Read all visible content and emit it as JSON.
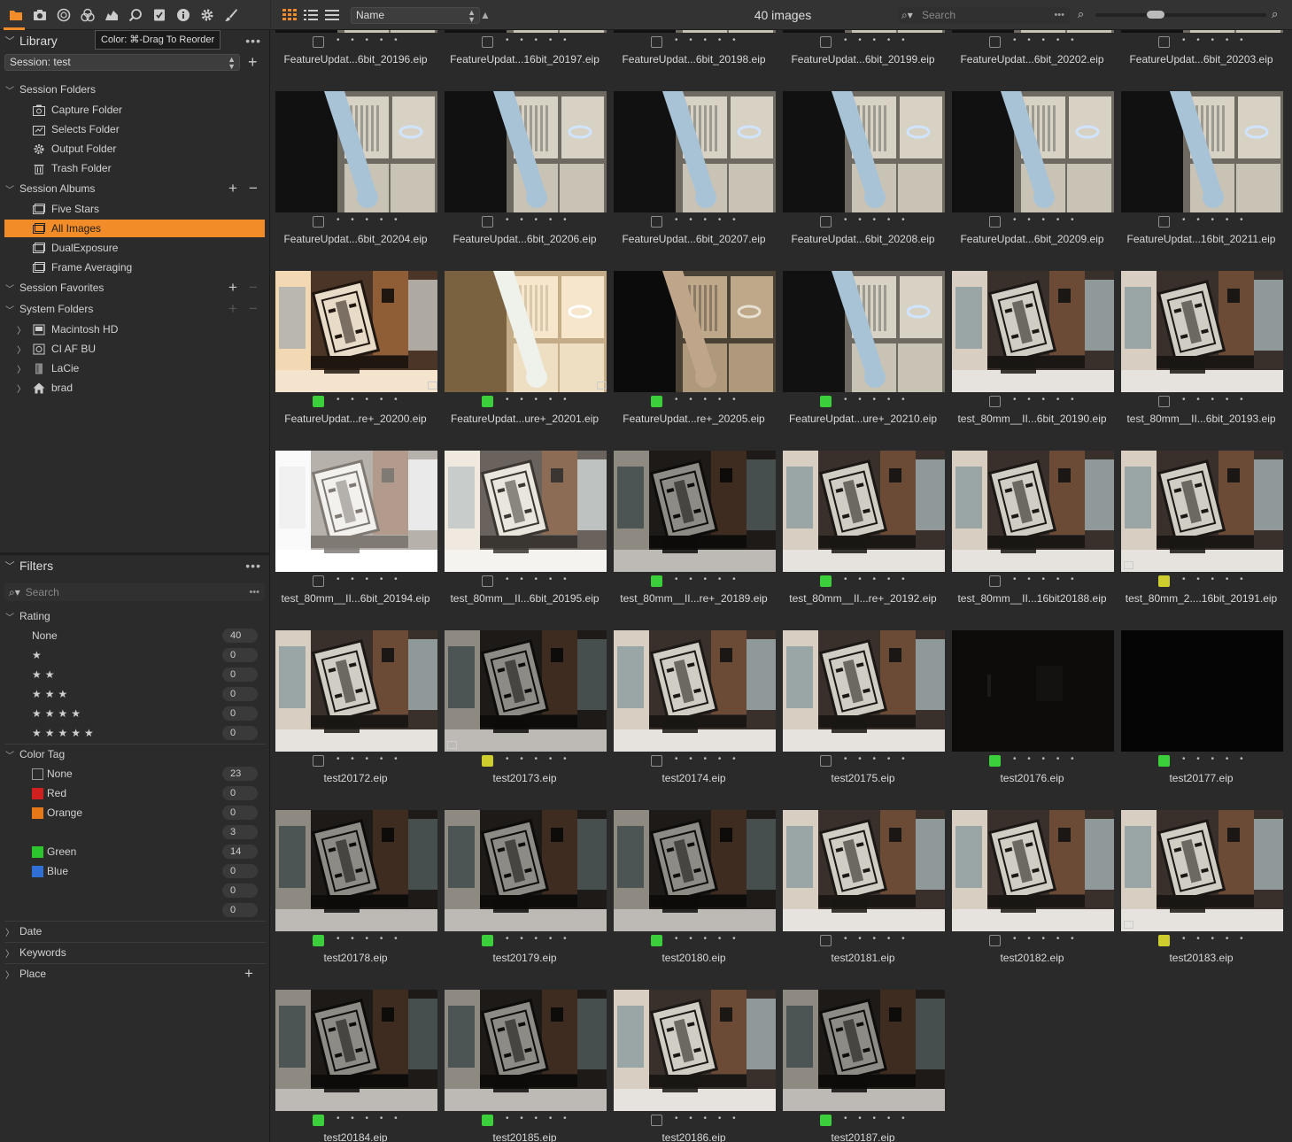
{
  "tool_tabs": [
    {
      "name": "library-tab-icon",
      "glyph": "folder",
      "active": true
    },
    {
      "name": "capture-tab-icon",
      "glyph": "camera"
    },
    {
      "name": "lens-tab-icon",
      "glyph": "circle"
    },
    {
      "name": "color-tab-icon",
      "glyph": "rgb"
    },
    {
      "name": "exposure-tab-icon",
      "glyph": "histogram"
    },
    {
      "name": "details-tab-icon",
      "glyph": "magnifier"
    },
    {
      "name": "adjustments-tab-icon",
      "glyph": "check"
    },
    {
      "name": "metadata-tab-icon",
      "glyph": "info"
    },
    {
      "name": "output-tab-icon",
      "glyph": "gear"
    },
    {
      "name": "brush-tab-icon",
      "glyph": "brush"
    }
  ],
  "library": {
    "title": "Library",
    "tooltip": "Color: ⌘-Drag To Reorder",
    "session": "Session: test",
    "sections": {
      "session_folders": "Session Folders",
      "session_albums": "Session Albums",
      "session_favorites": "Session Favorites",
      "system_folders": "System Folders"
    },
    "session_folders": [
      "Capture Folder",
      "Selects Folder",
      "Output Folder",
      "Trash Folder"
    ],
    "session_albums": [
      "Five Stars",
      "All Images",
      "DualExposure",
      "Frame Averaging"
    ],
    "system_folders": [
      "Macintosh HD",
      "CI AF BU",
      "LaCie",
      "brad"
    ],
    "selected_album": "All Images"
  },
  "filters": {
    "title": "Filters",
    "search_placeholder": "Search",
    "rating_title": "Rating",
    "rating": [
      {
        "label": "None",
        "count": "40"
      },
      {
        "stars": "★",
        "count": "0"
      },
      {
        "stars": "★★",
        "count": "0"
      },
      {
        "stars": "★★★",
        "count": "0"
      },
      {
        "stars": "★★★★",
        "count": "0"
      },
      {
        "stars": "★★★★★",
        "count": "0"
      }
    ],
    "color_tag_title": "Color Tag",
    "color_tags": [
      {
        "label": "None",
        "count": "23",
        "color": "none"
      },
      {
        "label": "Red",
        "count": "0",
        "color": "#d01f1f"
      },
      {
        "label": "Orange",
        "count": "0",
        "color": "#e77817"
      },
      {
        "label": "",
        "count": "3",
        "color": ""
      },
      {
        "label": "Green",
        "count": "14",
        "color": "#2dc52d"
      },
      {
        "label": "Blue",
        "count": "0",
        "color": "#2f6fd6"
      },
      {
        "label": "",
        "count": "0",
        "color": ""
      },
      {
        "label": "",
        "count": "0",
        "color": ""
      }
    ],
    "date": "Date",
    "keywords": "Keywords",
    "place": "Place"
  },
  "toolbar": {
    "sort_by": "Name",
    "image_count": "40 images",
    "search_placeholder": "Search",
    "zoom_level": 0.35
  },
  "browser": {
    "images": [
      {
        "name": "FeatureUpdat...6bit_20196.eip",
        "tag": "none",
        "scene": "top"
      },
      {
        "name": "FeatureUpdat...16bit_20197.eip",
        "tag": "none",
        "scene": "top"
      },
      {
        "name": "FeatureUpdat...6bit_20198.eip",
        "tag": "none",
        "scene": "top"
      },
      {
        "name": "FeatureUpdat...6bit_20199.eip",
        "tag": "none",
        "scene": "top"
      },
      {
        "name": "FeatureUpdat...6bit_20202.eip",
        "tag": "none",
        "scene": "top"
      },
      {
        "name": "FeatureUpdat...6bit_20203.eip",
        "tag": "none",
        "scene": "top"
      },
      {
        "name": "FeatureUpdat...6bit_20204.eip",
        "tag": "none",
        "scene": "lamp"
      },
      {
        "name": "FeatureUpdat...6bit_20206.eip",
        "tag": "none",
        "scene": "lamp"
      },
      {
        "name": "FeatureUpdat...6bit_20207.eip",
        "tag": "none",
        "scene": "lamp"
      },
      {
        "name": "FeatureUpdat...6bit_20208.eip",
        "tag": "none",
        "scene": "lamp"
      },
      {
        "name": "FeatureUpdat...6bit_20209.eip",
        "tag": "none",
        "scene": "lamp"
      },
      {
        "name": "FeatureUpdat...16bit_20211.eip",
        "tag": "none",
        "scene": "lamp"
      },
      {
        "name": "FeatureUpdat...re+_20200.eip",
        "tag": "green",
        "scene": "chart-warm",
        "badge": "right"
      },
      {
        "name": "FeatureUpdat...ure+_20201.eip",
        "tag": "green",
        "scene": "lamp-bright",
        "badge": "right"
      },
      {
        "name": "FeatureUpdat...re+_20205.eip",
        "tag": "green",
        "scene": "lamp-dark"
      },
      {
        "name": "FeatureUpdat...ure+_20210.eip",
        "tag": "green",
        "scene": "lamp"
      },
      {
        "name": "test_80mm__II...6bit_20190.eip",
        "tag": "none",
        "scene": "chart"
      },
      {
        "name": "test_80mm__II...6bit_20193.eip",
        "tag": "none",
        "scene": "chart"
      },
      {
        "name": "test_80mm__II...6bit_20194.eip",
        "tag": "none",
        "scene": "chart-white"
      },
      {
        "name": "test_80mm__II...6bit_20195.eip",
        "tag": "none",
        "scene": "chart-light"
      },
      {
        "name": "test_80mm__II...re+_20189.eip",
        "tag": "green",
        "scene": "chart-dark"
      },
      {
        "name": "test_80mm__II...re+_20192.eip",
        "tag": "green",
        "scene": "chart"
      },
      {
        "name": "test_80mm__II...16bit20188.eip",
        "tag": "none",
        "scene": "chart"
      },
      {
        "name": "test_80mm_2....16bit_20191.eip",
        "tag": "yellow",
        "scene": "chart",
        "badge": "left"
      },
      {
        "name": "test20172.eip",
        "tag": "none",
        "scene": "chart"
      },
      {
        "name": "test20173.eip",
        "tag": "yellow",
        "scene": "chart-dark",
        "badge": "left"
      },
      {
        "name": "test20174.eip",
        "tag": "none",
        "scene": "chart"
      },
      {
        "name": "test20175.eip",
        "tag": "none",
        "scene": "chart"
      },
      {
        "name": "test20176.eip",
        "tag": "green",
        "scene": "black-dim"
      },
      {
        "name": "test20177.eip",
        "tag": "green",
        "scene": "black"
      },
      {
        "name": "test20178.eip",
        "tag": "green",
        "scene": "chart-dark"
      },
      {
        "name": "test20179.eip",
        "tag": "green",
        "scene": "chart-dark"
      },
      {
        "name": "test20180.eip",
        "tag": "green",
        "scene": "chart-dark"
      },
      {
        "name": "test20181.eip",
        "tag": "none",
        "scene": "chart"
      },
      {
        "name": "test20182.eip",
        "tag": "none",
        "scene": "chart"
      },
      {
        "name": "test20183.eip",
        "tag": "yellow",
        "scene": "chart",
        "badge": "left"
      },
      {
        "name": "test20184.eip",
        "tag": "green",
        "scene": "chart-dark"
      },
      {
        "name": "test20185.eip",
        "tag": "green",
        "scene": "chart-dark"
      },
      {
        "name": "test20186.eip",
        "tag": "none",
        "scene": "chart"
      },
      {
        "name": "test20187.eip",
        "tag": "green",
        "scene": "chart-dark"
      }
    ],
    "rating_dots": "• • • • •"
  }
}
